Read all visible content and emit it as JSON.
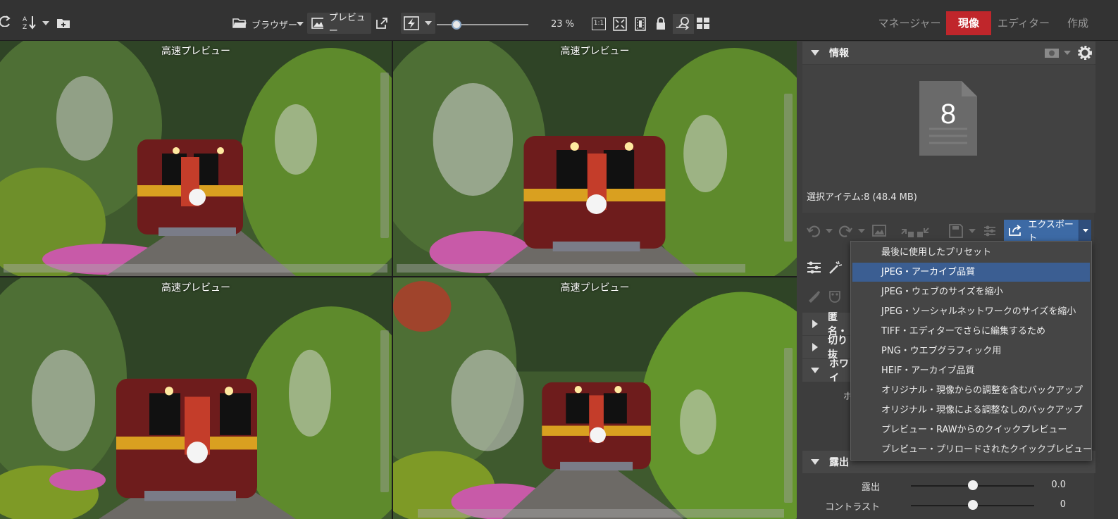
{
  "toolbar": {
    "browser_label": "ブラウザー",
    "preview_label": "プレビュー",
    "zoom": "23 %",
    "one_to_one": "1:1"
  },
  "modes": {
    "manager": "マネージャー",
    "develop": "現像",
    "editor": "エディター",
    "create": "作成",
    "active": "develop"
  },
  "grid": {
    "thumbnails": [
      {
        "caption": "高速プレビュー"
      },
      {
        "caption": "高速プレビュー"
      },
      {
        "caption": "高速プレビュー"
      },
      {
        "caption": "高速プレビュー"
      }
    ]
  },
  "panel": {
    "info_title": "情報",
    "selection_count": "8",
    "selection_info": "選択アイテム:8 (48.4 MB)",
    "export_label": "エクスポート",
    "collapsed_sections": [
      "匿名・",
      "切り抜",
      "ホワイ"
    ],
    "white_label_fragment": "ホ",
    "exposure_section": "露出",
    "sliders": [
      {
        "label": "露出",
        "value": "0.0"
      },
      {
        "label": "コントラスト",
        "value": "0"
      }
    ]
  },
  "export_menu": {
    "items": [
      "最後に使用したプリセット",
      "JPEG・アーカイブ品質",
      "JPEG・ウェブのサイズを縮小",
      "JPEG・ソーシャルネットワークのサイズを縮小",
      "TIFF・エディターでさらに編集するため",
      "PNG・ウエブグラフィック用",
      "HEIF・アーカイブ品質",
      "オリジナル・現像からの調整を含むバックアップ",
      "オリジナル・現像による調整なしのバックアップ",
      "プレビュー・RAWからのクイックプレビュー",
      "プレビュー・プリロードされたクイックプレビュー"
    ],
    "highlighted_index": 1
  },
  "colors": {
    "accent_red": "#c0262b",
    "export_blue": "#3d6aa5",
    "menu_highlight": "#3b5e92"
  }
}
